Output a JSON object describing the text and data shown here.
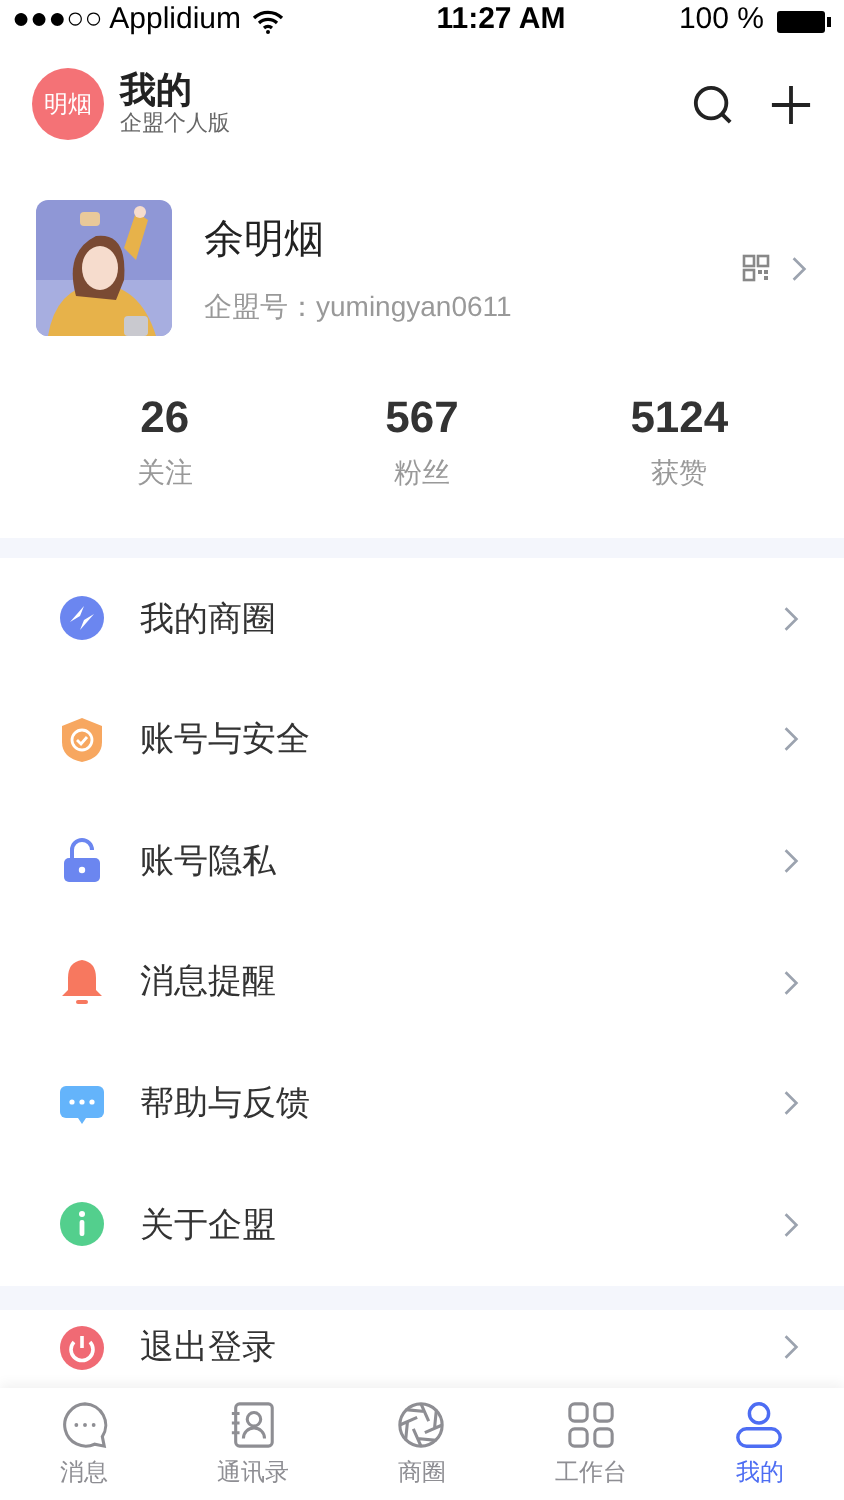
{
  "status_bar": {
    "carrier": "●●●○○ Applidium",
    "time": "11:27 AM",
    "battery": "100 %"
  },
  "header": {
    "badge": "明烟",
    "title": "我的",
    "subtitle": "企盟个人版"
  },
  "profile": {
    "name": "余明烟",
    "id_label": "企盟号：yumingyan0611"
  },
  "stats": [
    {
      "value": "26",
      "label": "关注"
    },
    {
      "value": "567",
      "label": "粉丝"
    },
    {
      "value": "5124",
      "label": "获赞"
    }
  ],
  "menu_groups": [
    [
      {
        "kind": "orbit",
        "label": "我的商圈"
      },
      {
        "kind": "shield",
        "label": "账号与安全"
      },
      {
        "kind": "lock",
        "label": "账号隐私"
      },
      {
        "kind": "bell",
        "label": "消息提醒"
      },
      {
        "kind": "chat",
        "label": "帮助与反馈"
      },
      {
        "kind": "info",
        "label": "关于企盟"
      }
    ],
    [
      {
        "kind": "power",
        "label": "退出登录"
      }
    ]
  ],
  "tab_bar": [
    {
      "kind": "chat",
      "label": "消息",
      "selected": false
    },
    {
      "kind": "contacts",
      "label": "通讯录",
      "selected": false
    },
    {
      "kind": "aperture",
      "label": "商圈",
      "selected": false
    },
    {
      "kind": "grid",
      "label": "工作台",
      "selected": false
    },
    {
      "kind": "person",
      "label": "我的",
      "selected": true
    }
  ]
}
